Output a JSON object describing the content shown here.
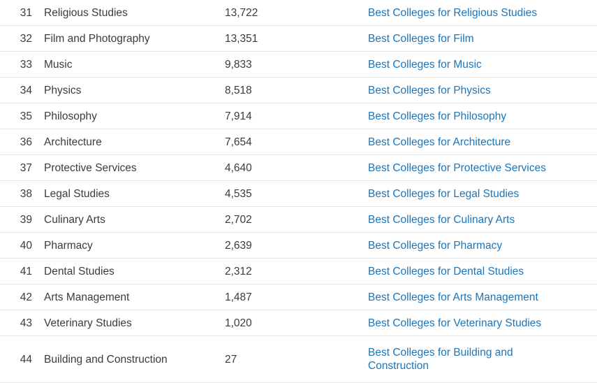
{
  "table": {
    "columns": [
      "rank",
      "major",
      "count",
      "link"
    ],
    "link_color": "#1a75bb",
    "text_color": "#3b3b3b",
    "divider_color": "#e7e7e7",
    "rows": [
      {
        "rank": "31",
        "major": "Religious Studies",
        "count": "13,722",
        "link": "Best Colleges for Religious Studies"
      },
      {
        "rank": "32",
        "major": "Film and Photography",
        "count": "13,351",
        "link": "Best Colleges for Film"
      },
      {
        "rank": "33",
        "major": "Music",
        "count": "9,833",
        "link": "Best Colleges for Music"
      },
      {
        "rank": "34",
        "major": "Physics",
        "count": "8,518",
        "link": "Best Colleges for Physics"
      },
      {
        "rank": "35",
        "major": "Philosophy",
        "count": "7,914",
        "link": "Best Colleges for Philosophy"
      },
      {
        "rank": "36",
        "major": "Architecture",
        "count": "7,654",
        "link": "Best Colleges for Architecture"
      },
      {
        "rank": "37",
        "major": "Protective Services",
        "count": "4,640",
        "link": "Best Colleges for Protective Services"
      },
      {
        "rank": "38",
        "major": "Legal Studies",
        "count": "4,535",
        "link": "Best Colleges for Legal Studies"
      },
      {
        "rank": "39",
        "major": "Culinary Arts",
        "count": "2,702",
        "link": "Best Colleges for Culinary Arts"
      },
      {
        "rank": "40",
        "major": "Pharmacy",
        "count": "2,639",
        "link": "Best Colleges for Pharmacy"
      },
      {
        "rank": "41",
        "major": "Dental Studies",
        "count": "2,312",
        "link": "Best Colleges for Dental Studies"
      },
      {
        "rank": "42",
        "major": "Arts Management",
        "count": "1,487",
        "link": "Best Colleges for Arts Management"
      },
      {
        "rank": "43",
        "major": "Veterinary Studies",
        "count": "1,020",
        "link": "Best Colleges for Veterinary Studies"
      },
      {
        "rank": "44",
        "major": "Building and Construction",
        "count": "27",
        "link": "Best Colleges for Building and Construction"
      }
    ]
  }
}
